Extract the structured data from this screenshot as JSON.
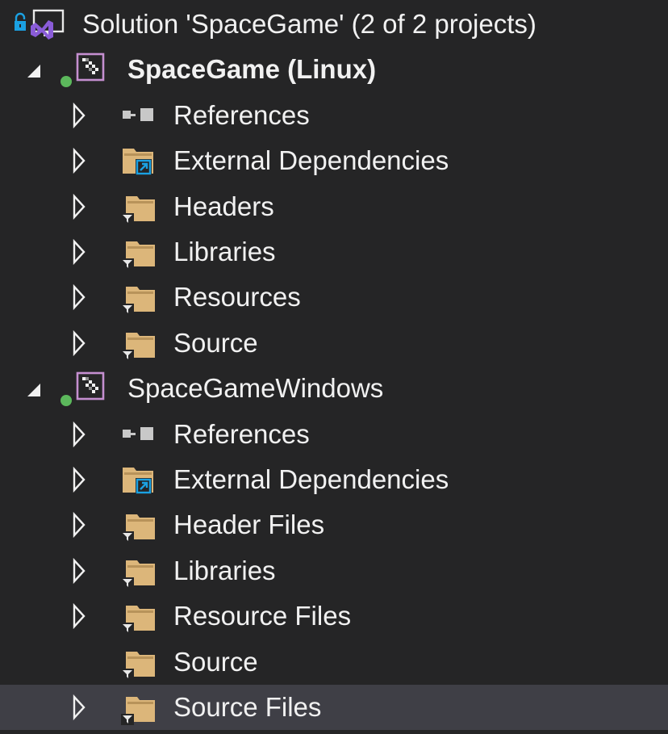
{
  "solution": {
    "label": "Solution 'SpaceGame' (2 of 2 projects)",
    "icons": [
      "lock-icon",
      "visual-studio-solution-icon"
    ]
  },
  "projects": [
    {
      "name": "SpaceGame (Linux)",
      "bold": true,
      "expanded": true,
      "status": "loaded",
      "items": [
        {
          "label": "References",
          "icon": "references-icon",
          "expandable": true
        },
        {
          "label": "External Dependencies",
          "icon": "external-dependencies-folder-icon",
          "expandable": true
        },
        {
          "label": "Headers",
          "icon": "filter-folder-icon",
          "expandable": true
        },
        {
          "label": "Libraries",
          "icon": "filter-folder-icon",
          "expandable": true
        },
        {
          "label": "Resources",
          "icon": "filter-folder-icon",
          "expandable": true
        },
        {
          "label": "Source",
          "icon": "filter-folder-icon",
          "expandable": true
        }
      ]
    },
    {
      "name": "SpaceGameWindows",
      "bold": false,
      "expanded": true,
      "status": "loaded",
      "items": [
        {
          "label": "References",
          "icon": "references-icon",
          "expandable": true
        },
        {
          "label": "External Dependencies",
          "icon": "external-dependencies-folder-icon",
          "expandable": true
        },
        {
          "label": "Header Files",
          "icon": "filter-folder-icon",
          "expandable": true
        },
        {
          "label": "Libraries",
          "icon": "filter-folder-icon",
          "expandable": true
        },
        {
          "label": "Resource Files",
          "icon": "filter-folder-icon",
          "expandable": true
        },
        {
          "label": "Source",
          "icon": "filter-folder-icon",
          "expandable": false
        },
        {
          "label": "Source Files",
          "icon": "filter-folder-icon",
          "expandable": true,
          "selected": true
        }
      ]
    }
  ],
  "colors": {
    "background": "#252526",
    "selection": "#3f3f46",
    "text": "#f1f1f1",
    "folder": "#dcb67a",
    "project_icon_border": "#c58fd0",
    "status_dot": "#5cb85c",
    "vs_purple": "#8a5cd8",
    "accent_blue": "#1ba1e2"
  }
}
